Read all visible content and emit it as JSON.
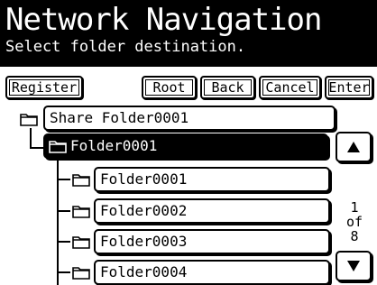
{
  "header": {
    "title": "Network Navigation",
    "subtitle": "Select folder destination."
  },
  "toolbar": {
    "register_label": "Register",
    "root_label": "Root",
    "back_label": "Back",
    "cancel_label": "Cancel",
    "enter_label": "Enter"
  },
  "tree": {
    "root_item": "Share Folder0001",
    "current_item": "Folder0001",
    "children": [
      "Folder0001",
      "Folder0002",
      "Folder0003",
      "Folder0004"
    ]
  },
  "pager": {
    "current": "1",
    "of": "of",
    "total": "8",
    "up_icon": "triangle-up-icon",
    "down_icon": "triangle-down-icon"
  }
}
